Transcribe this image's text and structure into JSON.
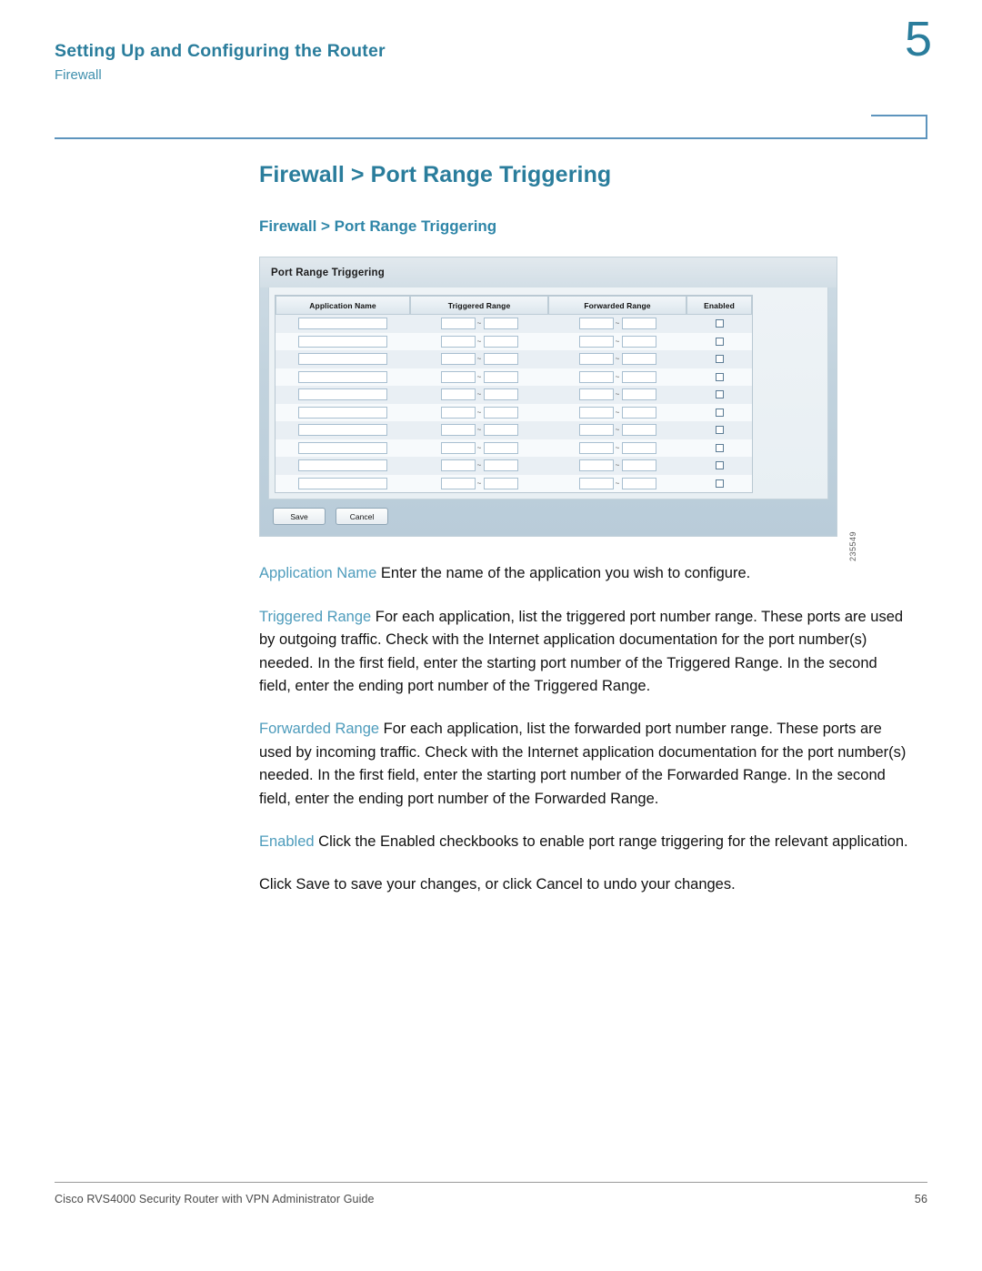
{
  "header": {
    "title": "Setting Up and Configuring the Router",
    "subtitle": "Firewall",
    "chapter_number": "5"
  },
  "content": {
    "heading1": "Firewall > Port Range Triggering",
    "heading2": "Firewall > Port Range Triggering"
  },
  "figure": {
    "panel_title": "Port Range Triggering",
    "figure_id": "235549",
    "columns": [
      "Application Name",
      "Triggered Range",
      "Forwarded Range",
      "Enabled"
    ],
    "row_count": 10,
    "range_separator": "~",
    "buttons": {
      "save": "Save",
      "cancel": "Cancel"
    }
  },
  "paragraphs": [
    {
      "term": "Application Name",
      "text": " Enter the name of the application you wish to configure."
    },
    {
      "term": "Triggered Range",
      "text": " For each application, list the triggered port number range. These ports are used by outgoing traffic. Check with the Internet application documentation for the port number(s) needed. In the first field, enter the starting port number of the Triggered Range. In the second field, enter the ending port number of the Triggered Range."
    },
    {
      "term": "Forwarded Range",
      "text": " For each application, list the forwarded port number range. These ports are used by incoming traffic. Check with the Internet application documentation for the port number(s) needed. In the first field, enter the starting port number of the Forwarded Range. In the second field, enter the ending port number of the Forwarded Range."
    },
    {
      "term": "Enabled",
      "text": " Click the Enabled checkbooks to enable port range triggering for the relevant application."
    },
    {
      "term": "",
      "text": "Click Save to save your changes, or click Cancel to undo your changes."
    }
  ],
  "footer": {
    "guide_title": "Cisco RVS4000 Security Router with VPN Administrator Guide",
    "page_number": "56"
  },
  "colors": {
    "accent_heading": "#2a7d9c",
    "accent_term": "#4e9cbc",
    "rule": "#5d94bd"
  }
}
